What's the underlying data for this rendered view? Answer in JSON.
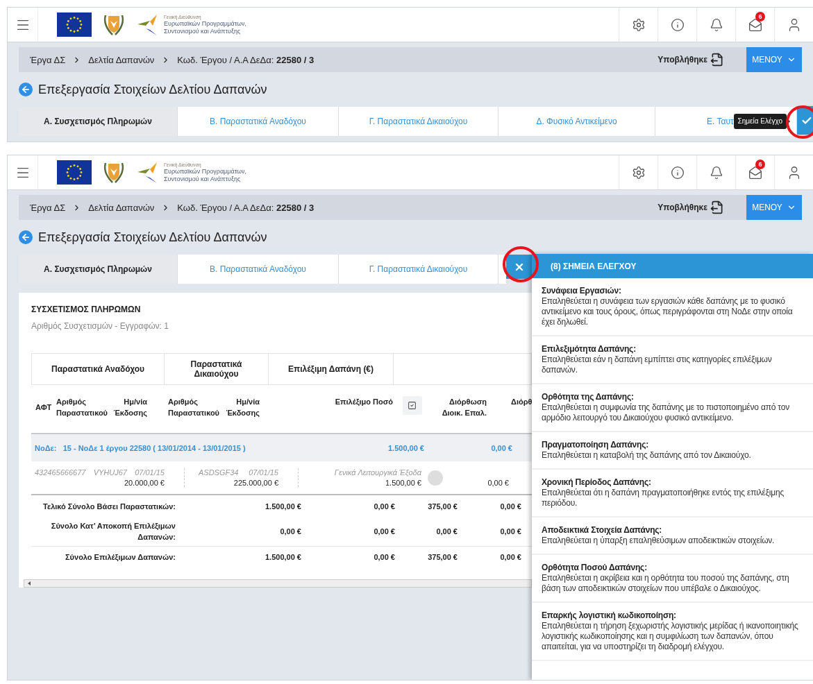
{
  "screens": [
    {
      "kind": "collapsed",
      "header": {
        "logo_text": [
          "Γενική Διεύθυνση",
          "Ευρωπαϊκών Προγραμμάτων,",
          "Συντονισμού και Ανάπτυξης"
        ],
        "mail_badge": "6"
      },
      "breadcrumb": [
        "Έργα ΔΣ",
        "Δελτία Δαπανών",
        "Κωδ. Έργου / Α.Α ΔεΔα: **22580 / 3**"
      ],
      "status": "Υποβλήθηκε",
      "menu_button": "ΜΕΝΟΥ",
      "page_title": "Επεξεργασία Στοιχείων Δελτίου Δαπανών",
      "tabs": [
        {
          "label": "Α. Συσχετισμός Πληρωμών",
          "selected": true
        },
        {
          "label": "Β. Παραστατικά Αναδόχου",
          "selected": false
        },
        {
          "label": "Γ. Παραστατικά Δικαιούχου",
          "selected": false
        },
        {
          "label": "Δ. Φυσικό Αντικείμενο",
          "selected": false
        },
        {
          "label": "Ε. Ταυτ",
          "selected": false
        }
      ],
      "checkpoints": {
        "tooltip": "Σημεία Ελέγχο"
      }
    },
    {
      "kind": "expanded",
      "header": {
        "logo_text": [
          "Γενική Διεύθυνση",
          "Ευρωπαϊκών Προγραμμάτων,",
          "Συντονισμού και Ανάπτυξης"
        ],
        "mail_badge": "6"
      },
      "breadcrumb": [
        "Έργα ΔΣ",
        "Δελτία Δαπανών",
        "Κωδ. Έργου / Α.Α ΔεΔα: **22580 / 3**"
      ],
      "status": "Υποβλήθηκε",
      "menu_button": "ΜΕΝΟΥ",
      "page_title": "Επεξεργασία Στοιχείων Δελτίου Δαπανών",
      "tabs": [
        {
          "label": "Α. Συσχετισμός Πληρωμών",
          "selected": true
        },
        {
          "label": "Β. Παραστατικά Αναδόχου",
          "selected": false
        },
        {
          "label": "Γ. Παραστατικά Δικαιούχου",
          "selected": false
        }
      ],
      "content": {
        "title": "ΣΥΣΧΕΤΙΣΜΟΣ ΠΛΗΡΩΜΩΝ",
        "subtitle": "Αριθμός Συσχετισμών - Εγγραφών: 1",
        "group_headers": [
          "Παραστατικά Αναδόχου",
          "Παραστατικά Δικαιούχου",
          "Επιλέξιμη Δαπάνη (€)"
        ],
        "columns": [
          "ΑΦΤ",
          "Αριθμός Παραστατικού",
          "Ημ/νία Έκδοσης",
          "Αριθμός Παραστατικού",
          "Ημ/νία Έκδοσης",
          "Επιλέξιμο Ποσό",
          "Διόρθωση Διοικ. Επαλ.",
          "Διόρθ"
        ],
        "node_row": {
          "label": "ΝοΔε:",
          "text": "15 - ΝοΔε 1 έργου 22580 ( 13/01/2014 - 13/01/2015 )",
          "amounts": [
            "1.500,00 €",
            "0,00 €"
          ]
        },
        "entry": {
          "contractor": {
            "afm": "432465666677",
            "number": "VYHUJ67",
            "date": "07/01/15",
            "amount": "20.000,00 €"
          },
          "beneficiary": {
            "number": "ASDSGF34",
            "date": "07/01/15",
            "amount": "225.000,00 €"
          },
          "category": "Γενικά Λειτουργικά Έξοδα",
          "eligible": "1.500,00 €",
          "correction": "0,00 €"
        },
        "totals": [
          {
            "label": "Τελικό Σύνολο Βάσει Παραστατικών:",
            "values": [
              "1.500,00 €",
              "0,00 €",
              "375,00 €",
              "0,00 €"
            ]
          },
          {
            "label": "Σύνολο Κατ’ Αποκοπή Επιλέξιμων Δαπανών:",
            "values": [
              "0,00 €",
              "0,00 €",
              "0,00 €",
              "0,00 €"
            ]
          },
          {
            "label": "Σύνολο Επιλέξιμων Δαπανών:",
            "values": [
              "1.500,00 €",
              "0,00 €",
              "375,00 €",
              "0,00 €"
            ]
          }
        ]
      },
      "checkpoints": {
        "title": "(8) ΣΗΜΕΙΑ ΕΛΕΓΧΟΥ",
        "items": [
          {
            "title": "Συνάφεια Εργασιών:",
            "text": "Επαληθεύεται η συνάφεια των εργασιών κάθε δαπάνης με το φυσικό αντικείμενο και τους όρους, όπως περιγράφονται στη ΝοΔε στην οποία έχει δηλωθεί."
          },
          {
            "title": "Επιλεξιμότητα Δαπάνης:",
            "text": "Επαληθεύεται εάν η δαπάνη εμπίπτει στις κατηγορίες επιλέξιμων δαπανών."
          },
          {
            "title": "Ορθότητα της Δαπάνης:",
            "text": "Επαληθεύεται η συμφωνία της δαπάνης με το πιστοποιημένο από τον αρμόδιο λειτουργό του Δικαιούχου φυσικό αντικείμενο."
          },
          {
            "title": "Πραγματοποίηση Δαπάνης:",
            "text": "Επαληθεύεται η καταβολή της δαπάνης από τον Δικαιούχο."
          },
          {
            "title": "Χρονική Περίοδος Δαπάνης:",
            "text": "Επαληθεύεται ότι η δαπάνη πραγματοποιήθηκε εντός της επιλέξιμης περιόδου."
          },
          {
            "title": "Αποδεικτικά Στοιχεία Δαπάνης:",
            "text": "Επαληθεύεται η ύπαρξη επαληθεύσιμων αποδεικτικών στοιχείων."
          },
          {
            "title": "Ορθότητα Ποσού Δαπάνης:",
            "text": "Επαληθεύεται η ακρίβεια και η ορθότητα του ποσού της δαπάνης, στη βάση των αποδεικτικών στοιχείων που υπέβαλε ο Δικαιούχος."
          },
          {
            "title": "Επαρκής λογιστική κωδικοποίηση:",
            "text": "Επαληθεύεται η τήρηση ξεχωριστής λογιστικής μερίδας ή ικανοποιητικής λογιστικής κωδικοποίησης και η συμφιλίωση των δαπανών, όπου απαιτείται, για να υποστηρίζει τη διαδρομή ελέγχου."
          }
        ]
      }
    }
  ]
}
